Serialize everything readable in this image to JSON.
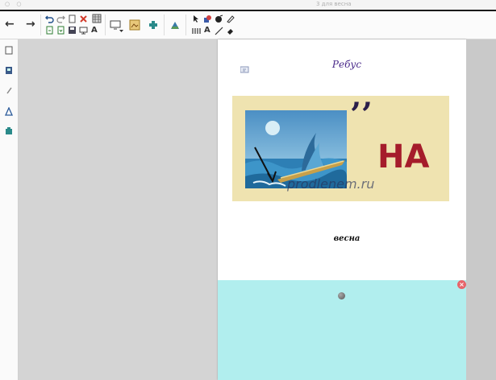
{
  "window": {
    "title": "3 для весна",
    "controls": "○ ○"
  },
  "toolbar": {
    "back_glyph": "←",
    "forward_glyph": "→",
    "text_tool_glyph": "A",
    "bold_text_glyph": "A"
  },
  "left_panel": {
    "items": [
      "page-sorter-icon",
      "gallery-icon",
      "attachments-icon",
      "properties-icon",
      "addons-icon"
    ]
  },
  "slide": {
    "title": "Ребус",
    "quote_marks": "’’",
    "syllable": "НА",
    "watermark": "prodlenem.ru",
    "answer": "весна"
  },
  "hidden_panel": {
    "close_glyph": "×"
  },
  "colors": {
    "title": "#4a2a8a",
    "syllable": "#a51c2b",
    "rebus_background": "#efe3b0",
    "hidden_area": "#b1eeee",
    "workspace": "#d4d4d4"
  }
}
